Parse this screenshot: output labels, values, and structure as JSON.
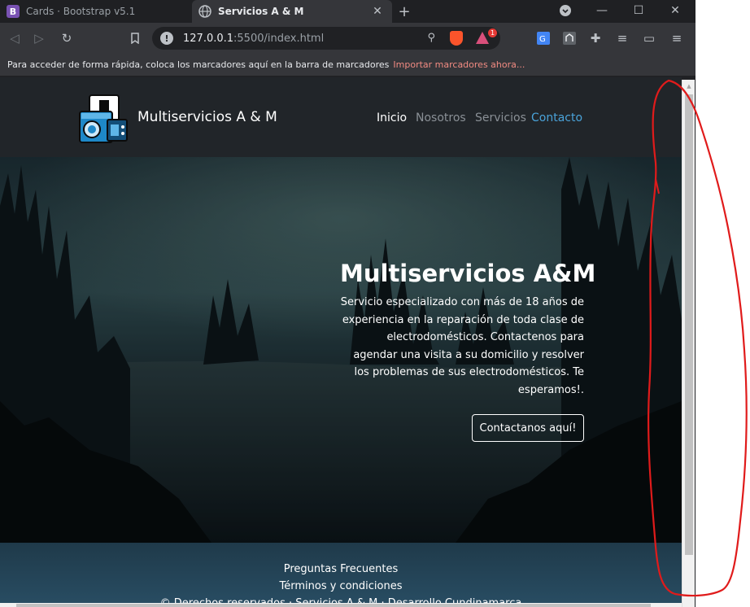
{
  "tabs": [
    {
      "title": "Cards · Bootstrap v5.1",
      "favicon_letter": "B",
      "favicon_color": "#7952b3"
    },
    {
      "title": "Servicios A & M"
    }
  ],
  "toolbar": {
    "url_host": "127.0.0.1",
    "url_rest": ":5500/index.html",
    "rewards_badge": "1"
  },
  "bookmarks": {
    "message": "Para acceder de forma rápida, coloca los marcadores aquí en la barra de marcadores",
    "import_link": "Importar marcadores ahora..."
  },
  "navbar": {
    "brand": "Multiservicios A & M",
    "links": [
      "Inicio",
      "Nosotros",
      "Servicios",
      "Contacto"
    ],
    "active_color": "#ffffff",
    "muted_color": "#8a9096",
    "accent_color": "#4aa3d9"
  },
  "hero": {
    "title": "Multiservicios A&M",
    "description": "Servicio especializado con más de 18 años de experiencia en la reparación de toda clase de electrodomésticos. Contactenos para agendar una visita a su domicilio y resolver los problemas de sus electrodomésticos. Te esperamos!.",
    "button": "Contactanos aquí!"
  },
  "footer": {
    "links": [
      "Preguntas Frecuentes",
      "Términos y condiciones",
      "© Derechos reservados · Servicios A & M · Desarrollo Cundinamarca"
    ]
  },
  "annotation_color": "#e01b1b"
}
